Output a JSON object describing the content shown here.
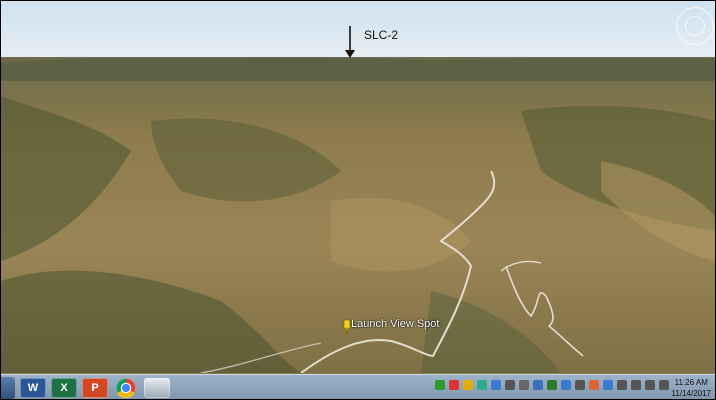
{
  "map": {
    "view": "3D terrain perspective",
    "annotations": {
      "slc_label": "SLC-2",
      "pin_label": "Launch View Spot"
    },
    "colors": {
      "sky": "#d6e6f2",
      "terrain_dry": "#a88c58",
      "terrain_veg": "#4f5a33",
      "road": "#e6e2d6",
      "pin": "#f2d21b"
    }
  },
  "taskbar": {
    "apps": [
      {
        "name": "word-icon",
        "glyph": "W",
        "color": "#2b5797"
      },
      {
        "name": "excel-icon",
        "glyph": "X",
        "color": "#1e7145"
      },
      {
        "name": "powerpoint-icon",
        "glyph": "P",
        "color": "#d24726"
      },
      {
        "name": "chrome-icon",
        "glyph": "",
        "color": "#dd4b39"
      },
      {
        "name": "google-earth-icon",
        "glyph": "",
        "color": "#7a8a9a"
      }
    ],
    "tray_colors": [
      "#2d9c2d",
      "#d33",
      "#e0b000",
      "#3a8",
      "#3c7ad0",
      "#555",
      "#666",
      "#3a6fbf",
      "#2a7a2a",
      "#3c7ad0",
      "#555",
      "#d63",
      "#3c7ad0",
      "#555",
      "#555",
      "#555",
      "#555"
    ],
    "clock": {
      "time": "11:26 AM",
      "date": "11/14/2017"
    }
  }
}
